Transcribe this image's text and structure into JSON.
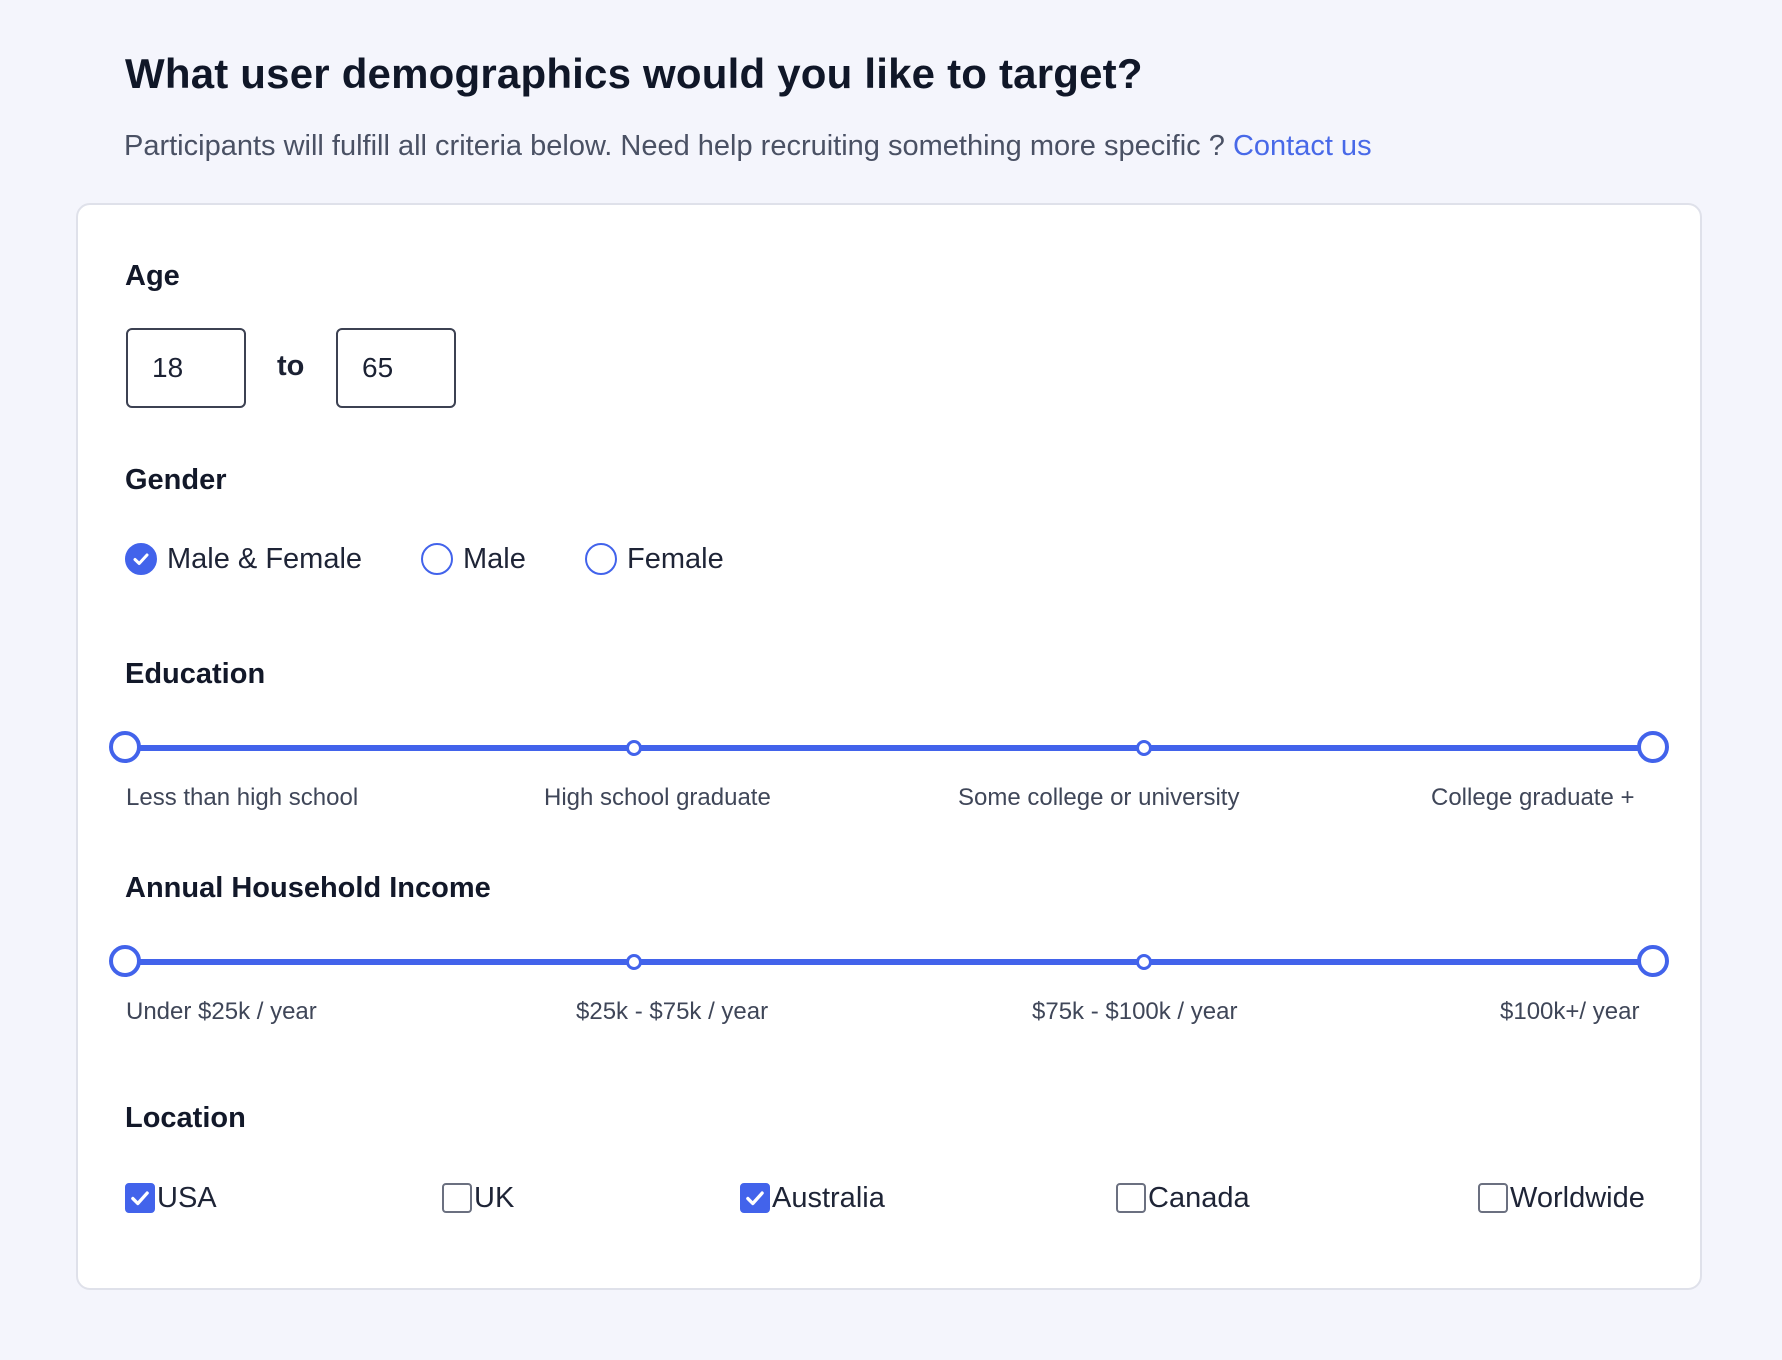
{
  "header": {
    "title": "What user demographics would you like to target?",
    "subtitle": "Participants will fulfill all criteria below. Need help recruiting something more specific ?",
    "contact_link": "Contact us"
  },
  "age": {
    "label": "Age",
    "min_value": "18",
    "separator": "to",
    "max_value": "65"
  },
  "gender": {
    "label": "Gender",
    "options": [
      {
        "label": "Male & Female",
        "checked": true
      },
      {
        "label": "Male",
        "checked": false
      },
      {
        "label": "Female",
        "checked": false
      }
    ]
  },
  "education": {
    "label": "Education",
    "ticks": [
      "Less than high school",
      "High school graduate",
      "Some college or university",
      "College graduate +"
    ],
    "selected_range": [
      "Less than high school",
      "College graduate +"
    ]
  },
  "income": {
    "label": "Annual Household Income",
    "ticks": [
      "Under $25k / year",
      "$25k - $75k / year",
      "$75k - $100k / year",
      "$100k+/ year"
    ],
    "selected_range": [
      "Under $25k / year",
      "$100k+/ year"
    ]
  },
  "location": {
    "label": "Location",
    "options": [
      {
        "label": "USA",
        "checked": true
      },
      {
        "label": "UK",
        "checked": false
      },
      {
        "label": "Australia",
        "checked": true
      },
      {
        "label": "Canada",
        "checked": false
      },
      {
        "label": "Worldwide",
        "checked": false
      }
    ]
  },
  "colors": {
    "accent": "#4263eb",
    "link": "#4869e8"
  },
  "icons": {
    "check": "checkmark-icon"
  }
}
